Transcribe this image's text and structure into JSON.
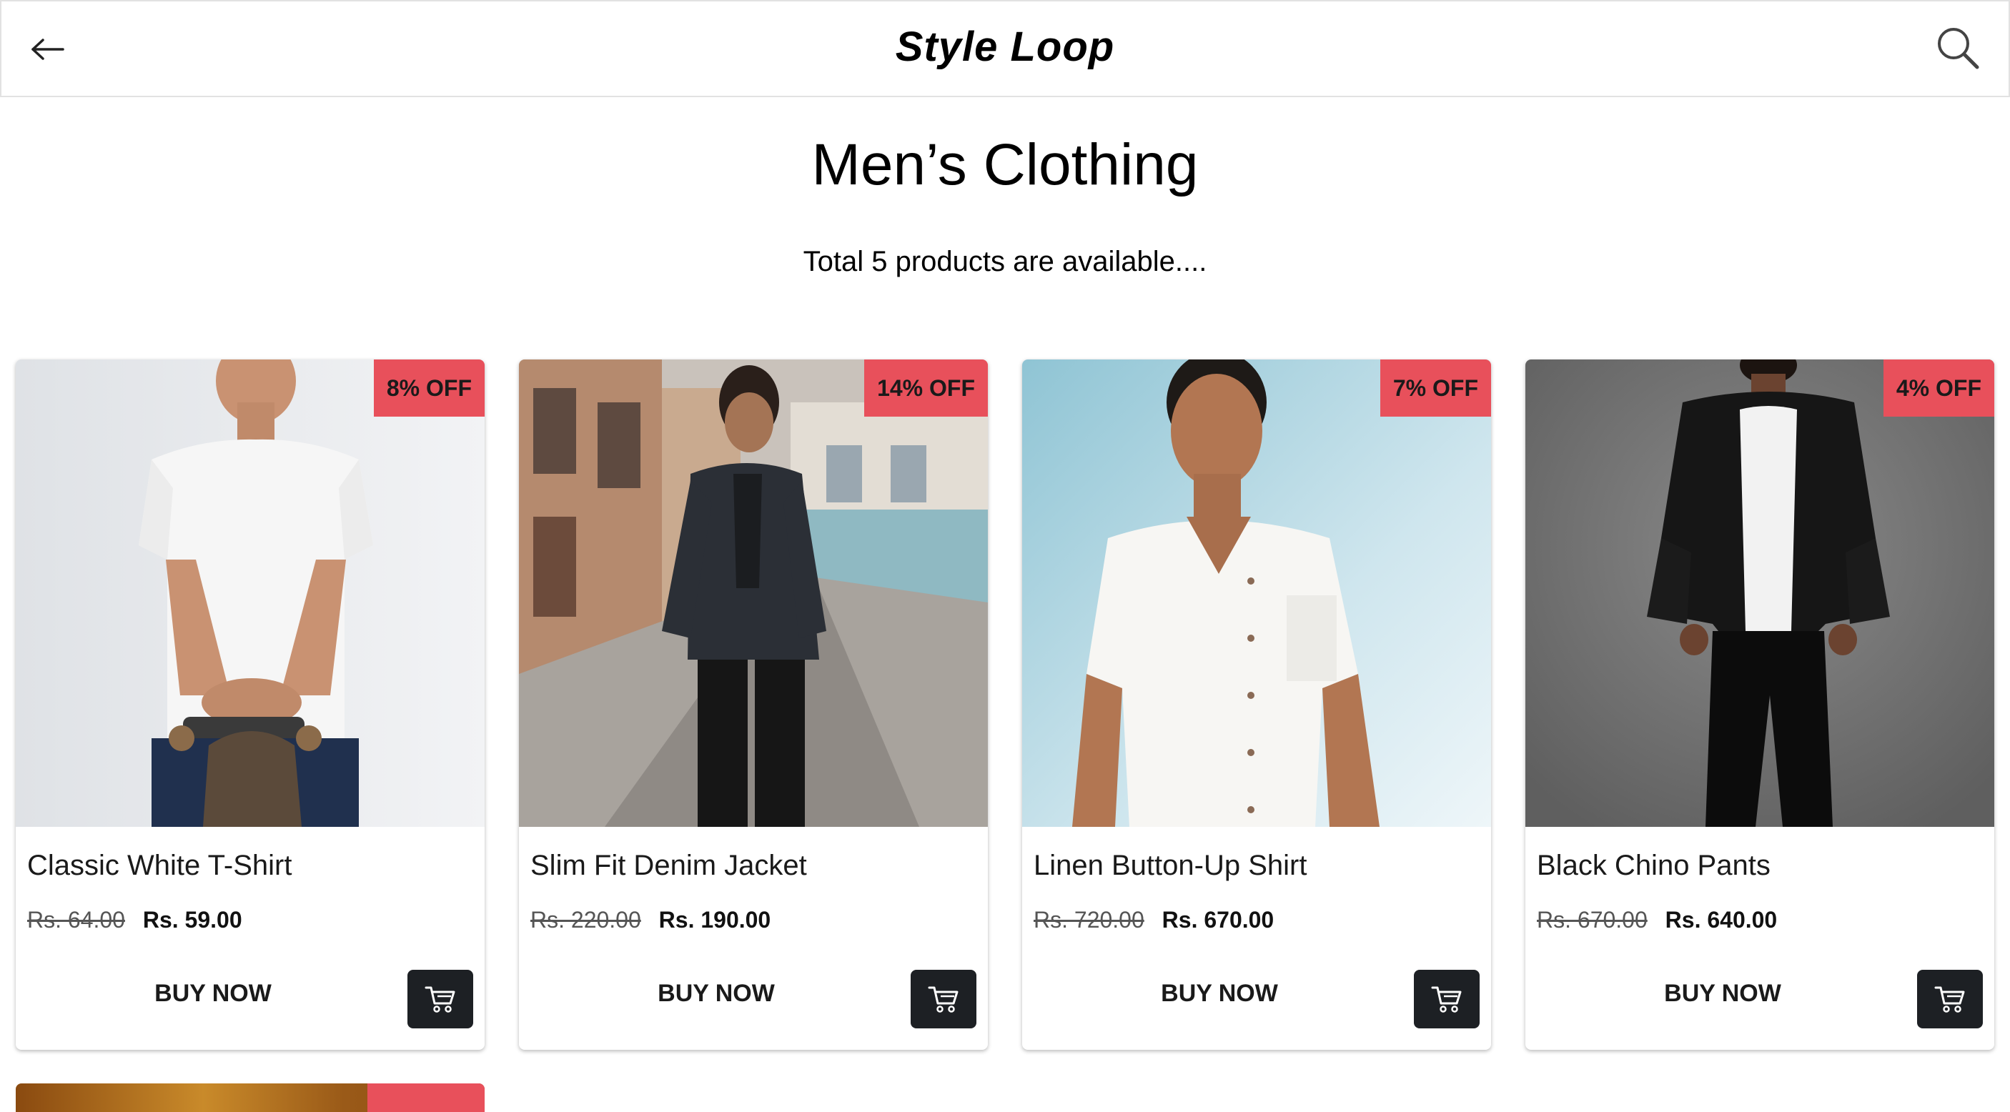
{
  "header": {
    "brand": "Style Loop",
    "back_icon": "arrow-left-icon",
    "search_icon": "search-icon"
  },
  "page": {
    "title": "Men’s Clothing",
    "subtitle": "Total 5 products are available...."
  },
  "products": [
    {
      "name": "Classic White T-Shirt",
      "discount": "8% OFF",
      "old_price": "Rs. 64.00",
      "new_price": "Rs. 59.00",
      "buy_label": "BUY NOW",
      "cart_icon": "cart-icon"
    },
    {
      "name": "Slim Fit Denim Jacket",
      "discount": "14% OFF",
      "old_price": "Rs. 220.00",
      "new_price": "Rs. 190.00",
      "buy_label": "BUY NOW",
      "cart_icon": "cart-icon"
    },
    {
      "name": "Linen Button-Up Shirt",
      "discount": "7% OFF",
      "old_price": "Rs. 720.00",
      "new_price": "Rs. 670.00",
      "buy_label": "BUY NOW",
      "cart_icon": "cart-icon"
    },
    {
      "name": "Black Chino Pants",
      "discount": "4% OFF",
      "old_price": "Rs. 670.00",
      "new_price": "Rs. 640.00",
      "buy_label": "BUY NOW",
      "cart_icon": "cart-icon"
    }
  ],
  "colors": {
    "badge": "#e8505b",
    "cart_button": "#1d2024",
    "header_border": "#e2e2e2"
  }
}
